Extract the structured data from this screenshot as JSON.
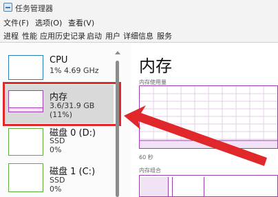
{
  "window": {
    "title": "任务管理器"
  },
  "menu": [
    "文件(F)",
    "选项(O)",
    "查看(V)"
  ],
  "tabs": [
    "进程",
    "性能",
    "应用历史记录",
    "启动",
    "用户",
    "详细信息",
    "服务"
  ],
  "sidebar": {
    "items": [
      {
        "title": "CPU",
        "sub1": "1%  4.69 GHz",
        "sub2": ""
      },
      {
        "title": "内存",
        "sub1": "3.6/31.9 GB (11%)",
        "sub2": ""
      },
      {
        "title": "磁盘 0 (D:)",
        "sub1": "SSD",
        "sub2": "0%"
      },
      {
        "title": "磁盘 1 (C:)",
        "sub1": "SSD",
        "sub2": "0%"
      }
    ]
  },
  "detail": {
    "heading": "内存",
    "usage_label": "内存使用量",
    "time_label": "60 秒",
    "composition_label": "内存组合"
  },
  "colors": {
    "accent_cpu": "#2a7db6",
    "accent_memory": "#9b3fb0",
    "annotation_red": "#e0282b"
  }
}
